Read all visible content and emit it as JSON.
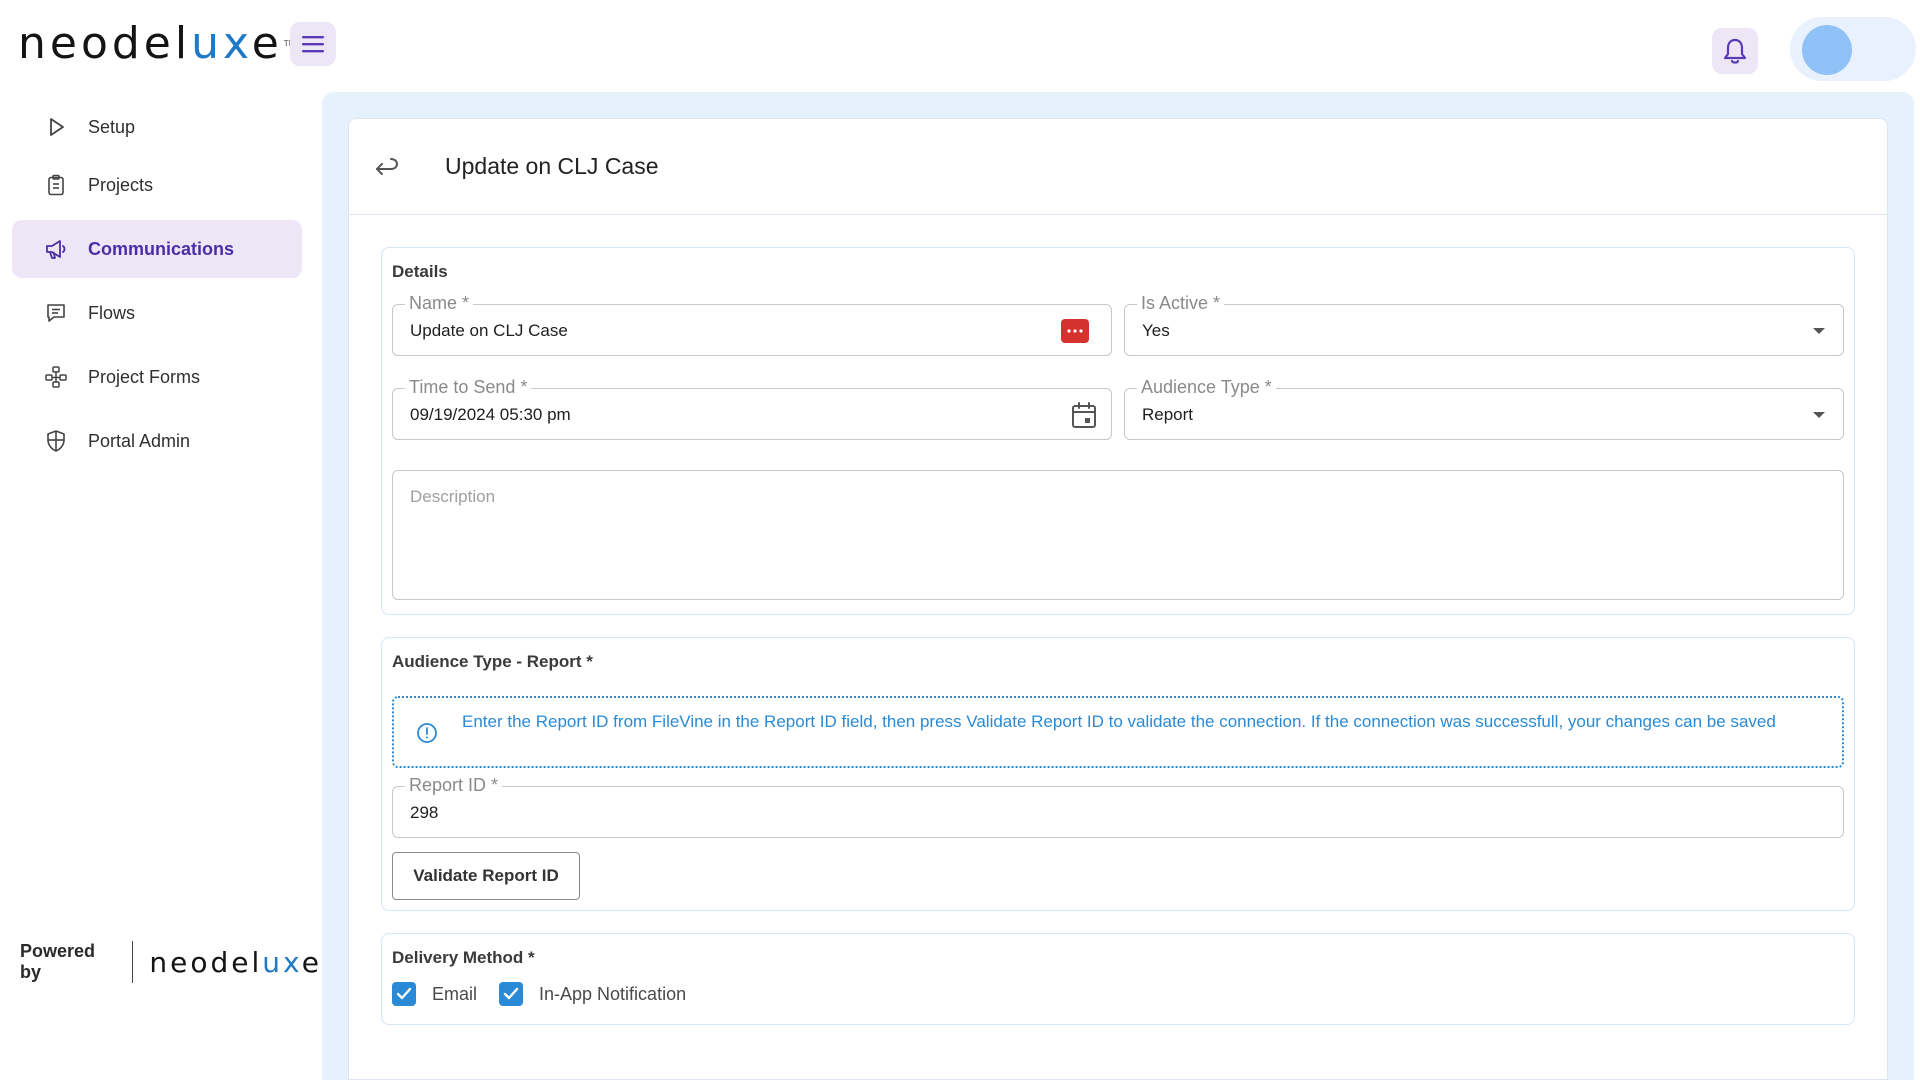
{
  "brand": {
    "logo_prefix": "neodel",
    "logo_accent": "ux",
    "logo_suffix": "e",
    "logo_tm": "TM"
  },
  "header": {
    "menu_icon": "hamburger-icon",
    "bell_icon": "bell-icon"
  },
  "sidebar": {
    "items": [
      {
        "label": "Setup",
        "icon": "play-icon"
      },
      {
        "label": "Projects",
        "icon": "clipboard-icon"
      },
      {
        "label": "Communications",
        "icon": "megaphone-icon",
        "active": true
      },
      {
        "label": "Flows",
        "icon": "chat-icon"
      },
      {
        "label": "Project Forms",
        "icon": "nodes-icon"
      },
      {
        "label": "Portal Admin",
        "icon": "shield-icon"
      }
    ],
    "powered_by": "Powered by",
    "footer_logo_prefix": "neodel",
    "footer_logo_accent": "ux",
    "footer_logo_suffix": "e"
  },
  "page": {
    "title": "Update on CLJ Case"
  },
  "details": {
    "title": "Details",
    "name_label": "Name *",
    "name_value": "Update on CLJ Case",
    "is_active_label": "Is Active *",
    "is_active_value": "Yes",
    "time_label": "Time to Send *",
    "time_value": "09/19/2024 05:30 pm",
    "audience_label": "Audience Type *",
    "audience_value": "Report",
    "description_placeholder": "Description"
  },
  "audience_report": {
    "title": "Audience Type - Report *",
    "info": "Enter the Report ID from FileVine in the Report ID field, then press Validate Report ID to validate the connection. If the connection was successfull, your changes can be saved",
    "report_id_label": "Report ID *",
    "report_id_value": "298",
    "validate_label": "Validate Report ID"
  },
  "delivery": {
    "title": "Delivery Method *",
    "email_label": "Email",
    "inapp_label": "In-App Notification"
  },
  "colors": {
    "accent": "#4a2ea8",
    "info": "#2a8ad6",
    "active_bg": "#ece6f6",
    "page_bg": "#e5f1fd"
  }
}
